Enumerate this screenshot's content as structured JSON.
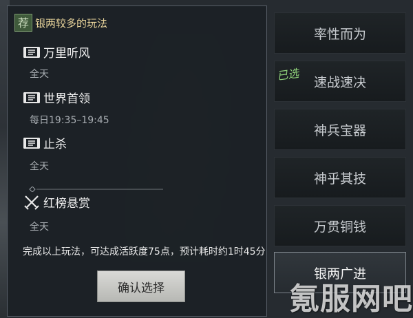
{
  "panel": {
    "badge": "荐",
    "title": "银两较多的玩法",
    "entries": [
      {
        "name": "万里听风",
        "detail": "全天",
        "icon": "scroll-icon"
      },
      {
        "name": "世界首领",
        "detail": "每日19:35–19:45",
        "icon": "scroll-icon"
      },
      {
        "name": "止杀",
        "detail": "全天",
        "icon": "scroll-icon"
      },
      {
        "name": "红榜悬赏",
        "detail": "全天",
        "icon": "crossed-swords-icon"
      }
    ],
    "summary": "完成以上玩法，可达成活跃度75点，预计耗时约1时45分",
    "confirm_label": "确认选择"
  },
  "options": {
    "chosen_label": "已选",
    "items": [
      {
        "label": "率性而为"
      },
      {
        "label": "速战速决"
      },
      {
        "label": "神兵宝器"
      },
      {
        "label": "神乎其技"
      },
      {
        "label": "万贯铜钱"
      },
      {
        "label": "银两广进"
      }
    ]
  },
  "watermark": "氪服网吧",
  "colors": {
    "panel_title": "#e7d39a",
    "chosen_mark": "#8fd17a",
    "confirm_bg": "#c9cac6"
  }
}
